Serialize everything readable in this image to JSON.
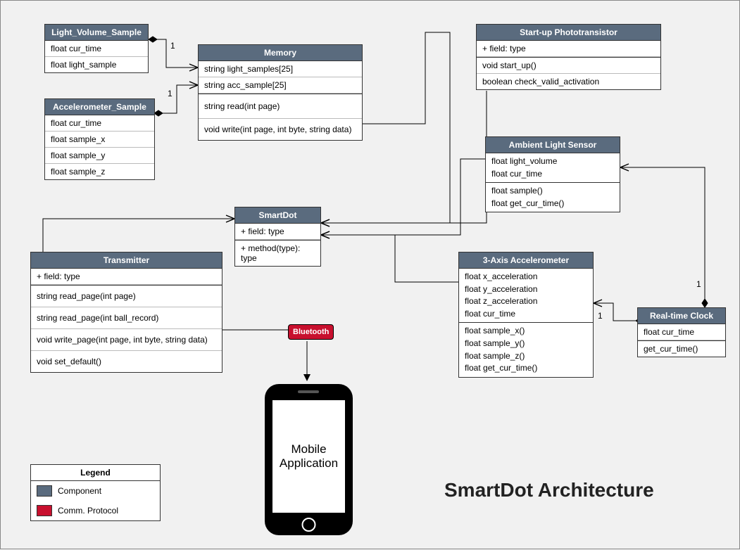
{
  "title": "SmartDot Architecture",
  "legend": {
    "title": "Legend",
    "component": "Component",
    "comm": "Comm. Protocol"
  },
  "bluetooth": "Bluetooth",
  "mobile_line1": "Mobile",
  "mobile_line2": "Application",
  "mult1": "1",
  "boxes": {
    "light_sample": {
      "title": "Light_Volume_Sample",
      "r1": "float cur_time",
      "r2": "float light_sample"
    },
    "accel_sample": {
      "title": "Accelerometer_Sample",
      "r1": "float cur_time",
      "r2": "float sample_x",
      "r3": "float sample_y",
      "r4": "float sample_z"
    },
    "memory": {
      "title": "Memory",
      "r1": "string light_samples[25]",
      "r2": "string acc_sample[25]",
      "r3": "string read(int page)",
      "r4": "void write(int page, int byte, string data)"
    },
    "startup": {
      "title": "Start-up Phototransistor",
      "r1": "+ field: type",
      "r2": "void start_up()",
      "r3": "boolean check_valid_activation"
    },
    "ambient": {
      "title": "Ambient Light Sensor",
      "a1": "float light_volume",
      "a2": "float cur_time",
      "m1": "float sample()",
      "m2": "float get_cur_time()"
    },
    "smartdot": {
      "title": "SmartDot",
      "r1": "+ field: type",
      "r2": "+ method(type): type"
    },
    "transmitter": {
      "title": "Transmitter",
      "r1": "+ field: type",
      "r2": "string read_page(int page)",
      "r3": "string read_page(int ball_record)",
      "r4": "void write_page(int page, int byte, string data)",
      "r5": "void set_default()"
    },
    "accel": {
      "title": "3-Axis Accelerometer",
      "a1": "float x_acceleration",
      "a2": "float y_acceleration",
      "a3": "float z_acceleration",
      "a4": "float cur_time",
      "m1": "float sample_x()",
      "m2": "float sample_y()",
      "m3": "float sample_z()",
      "m4": "float get_cur_time()"
    },
    "clock": {
      "title": "Real-time Clock",
      "r1": "float cur_time",
      "r2": "get_cur_time()"
    }
  }
}
